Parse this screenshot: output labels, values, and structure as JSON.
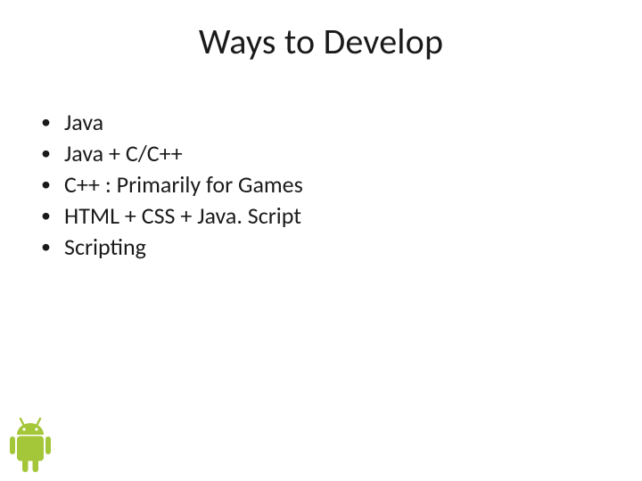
{
  "title": "Ways to Develop",
  "bullets": [
    "Java",
    "Java + C/C++",
    "C++ : Primarily for Games",
    "HTML + CSS + Java. Script",
    "Scripting"
  ],
  "logo": {
    "name": "android-logo",
    "fill": "#A4C639"
  }
}
